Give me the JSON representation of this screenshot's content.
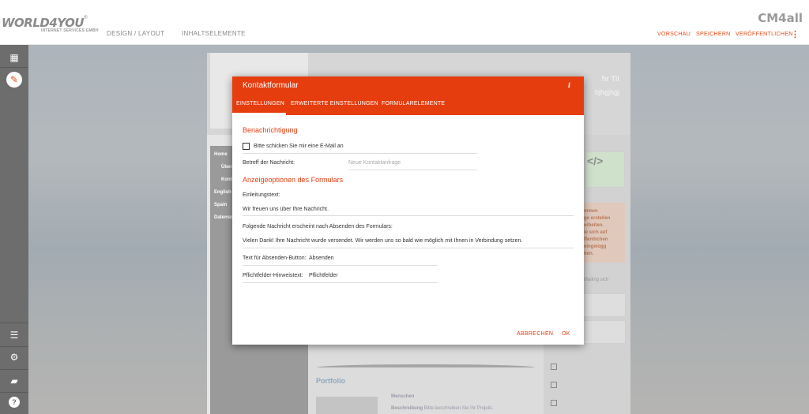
{
  "topbar": {
    "logo_text": "WORLD4YOU",
    "logo_sub": "INTERNET SERVICES GMBH",
    "tabs": [
      "DESIGN / LAYOUT",
      "INHALTSELEMENTE"
    ],
    "brand": "CM4all",
    "actions": [
      "VORSCHAU",
      "SPEICHERN",
      "VERÖFFENTLICHEN"
    ]
  },
  "site": {
    "hero_text1": "hr Tit",
    "hero_text2": "bjhgjhgj",
    "nav": [
      "Home",
      "Über",
      "Kont",
      "English",
      "Spain",
      "Datensc"
    ],
    "portfolio_title": "Portfolio",
    "portfolio_heading": "Menschen",
    "portfolio_desc_label": "Beschreibung",
    "portfolio_desc": "Bitte beschreiben Sie Ihr Projekt.",
    "warn_lines": [
      "mmen",
      "ge erstellen",
      "erbeiten.",
      "ie sich auf",
      "ffentlichen",
      "eingelogg",
      "ben."
    ],
    "side_text": "Mailing sich"
  },
  "modal": {
    "title": "Kontaktformular",
    "info": "i",
    "tabs": [
      "EINSTELLUNGEN",
      "ERWEITERTE EINSTELLUNGEN",
      "FORMULARELEMENTE"
    ],
    "section1": "Benachrichtigung",
    "checkbox_label": "Bitte schicken Sie mir eine E-Mail an",
    "subject_label": "Betreff der Nachricht:",
    "subject_placeholder": "Neue Kontaktanfrage",
    "section2": "Anzeigeoptionen des Formulars",
    "intro_label": "Einleitungstext:",
    "intro_value": "Wir freuen uns über Ihre Nachricht.",
    "after_label": "Folgende Nachricht erscheint nach Absenden des Formulars:",
    "after_value": "Vielen Dank! Ihre Nachricht wurde versendet. Wir werden uns so bald wie möglich mit Ihnen in Verbindung setzen.",
    "button_label": "Text für Absenden-Button:",
    "button_value": "Absenden",
    "required_label": "Pflichtfelder-Hinweistext:",
    "required_value": "Pflichtfelder",
    "cancel": "ABBRECHEN",
    "ok": "OK"
  },
  "colors": {
    "accent": "#e63d0f",
    "rail": "#6d6d6d"
  },
  "icons": [
    "dashboard-icon",
    "brush-icon",
    "sort-icon",
    "settings-icon",
    "chat-icon",
    "help-icon",
    "info-icon",
    "code-icon"
  ]
}
